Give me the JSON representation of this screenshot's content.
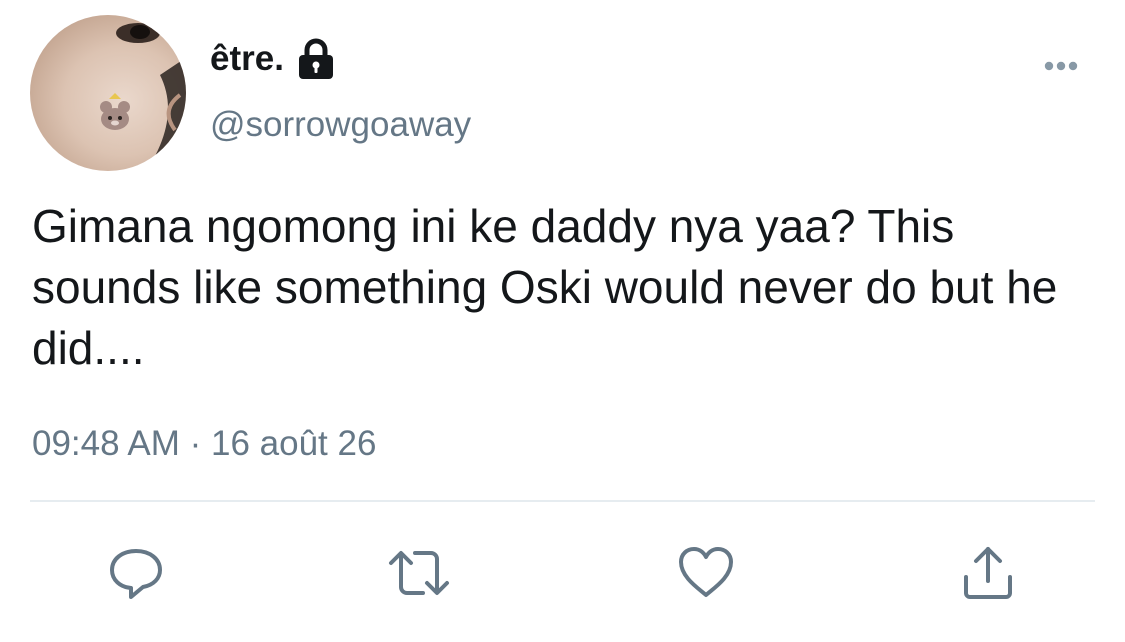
{
  "tweet": {
    "display_name": "être.",
    "handle": "@sorrowgoaway",
    "text": "Gimana ngomong ini ke daddy nya yaa? This sounds like something Oski would never do but he did....",
    "timestamp": "09:48 AM · 16 août 26",
    "protected": true
  },
  "icons": {
    "avatar": "profile-photo",
    "lock": "lock-icon",
    "more": "more-horizontal-icon",
    "reply": "reply-icon",
    "retweet": "retweet-icon",
    "like": "heart-icon",
    "share": "share-icon"
  },
  "colors": {
    "text": "#14171a",
    "secondary": "#657786",
    "divider": "#e6ecf0",
    "action_icon": "#657786"
  }
}
